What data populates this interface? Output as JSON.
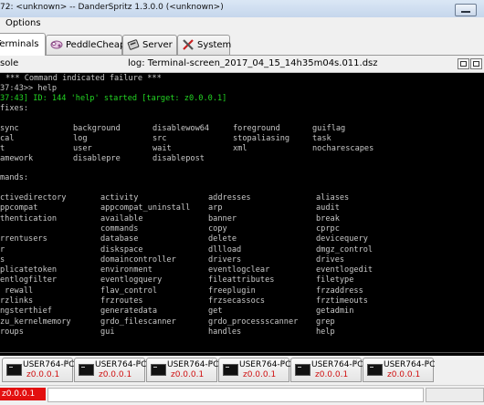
{
  "window": {
    "title": "72: <unknown> -- DanderSpritz 1.3.0.0 (<unknown>)"
  },
  "menu": {
    "options": "Options"
  },
  "tabs": [
    {
      "label": "Terminals",
      "icon": "terminals-icon",
      "active": true
    },
    {
      "label": "PeddleCheap",
      "icon": "peddlecheap-icon",
      "active": false
    },
    {
      "label": "Server",
      "icon": "server-icon",
      "active": false
    },
    {
      "label": "System",
      "icon": "system-icon",
      "active": false
    }
  ],
  "console": {
    "label": "sole",
    "log": "log: Terminal-screen_2017_04_15_14h35m04s.011.dsz"
  },
  "terminal": {
    "lines": [
      {
        "text": "*** Command indicated failure ***",
        "color": "white"
      },
      {
        "text": "37:43>> help",
        "color": "white"
      },
      {
        "text": "37:43] ID: 144 'help' started [target: z0.0.0.1]",
        "color": "green"
      },
      {
        "text": "fixes:",
        "color": "white"
      }
    ],
    "prefixes": [
      [
        "sync",
        "background",
        "disablewow64",
        "foreground",
        "guiflag"
      ],
      [
        "cal",
        "log",
        "src",
        "stopaliasing",
        "task"
      ],
      [
        "t",
        "user",
        "wait",
        "xml",
        "nocharescapes"
      ],
      [
        "amework",
        "disablepre",
        "disablepost",
        "",
        ""
      ]
    ],
    "commands_header": "mands:",
    "commands": [
      [
        "ctivedirectory",
        "activity",
        "addresses",
        "aliases"
      ],
      [
        "ppcompat",
        "appcompat_uninstall",
        "arp",
        "audit"
      ],
      [
        "thentication",
        "available",
        "banner",
        "break"
      ],
      [
        "",
        "commands",
        "copy",
        "cprpc"
      ],
      [
        "rrentusers",
        "database",
        "delete",
        "devicequery"
      ],
      [
        "r",
        "diskspace",
        "dllload",
        "dmgz_control"
      ],
      [
        "s",
        "domaincontroller",
        "drivers",
        "drives"
      ],
      [
        "plicatetoken",
        "environment",
        "eventlogclear",
        "eventlogedit"
      ],
      [
        "entlogfilter",
        "eventlogquery",
        "fileattributes",
        "filetype"
      ],
      [
        " rewall",
        "flav_control",
        "freeplugin",
        "frzaddress"
      ],
      [
        "rzlinks",
        "frzroutes",
        "frzsecassocs",
        "frztimeouts"
      ],
      [
        "ngsterthief",
        "generatedata",
        "get",
        "getadmin"
      ],
      [
        "zu_kernelmemory",
        "grdo_filescanner",
        "grdo_processscanner",
        "grep"
      ],
      [
        "roups",
        "gui",
        "handles",
        "help"
      ]
    ]
  },
  "sessions": [
    {
      "name": "USER764-PC",
      "ip": "z0.0.0.1"
    },
    {
      "name": "USER764-PC",
      "ip": "z0.0.0.1"
    },
    {
      "name": "USER764-PC",
      "ip": "z0.0.0.1"
    },
    {
      "name": "USER764-PC",
      "ip": "z0.0.0.1"
    },
    {
      "name": "USER764-PC",
      "ip": "z0.0.0.1"
    },
    {
      "name": "USER764-PC",
      "ip": "z0.0.0.1"
    }
  ],
  "status": {
    "ip": "z0.0.0.1"
  },
  "colors": {
    "terminal_bg": "#000000",
    "terminal_text": "#c8c8c8",
    "started_text": "#23d523",
    "ip_text": "#d01010",
    "status_ip_bg": "#e31010"
  }
}
